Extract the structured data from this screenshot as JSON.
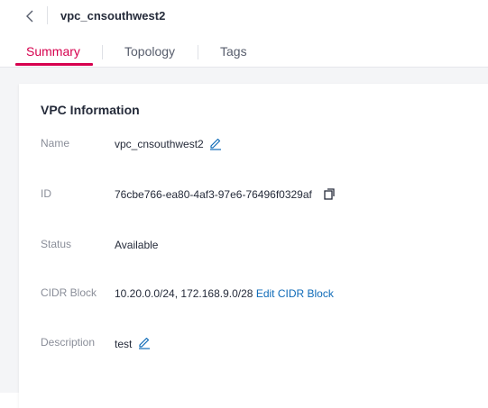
{
  "header": {
    "title": "vpc_cnsouthwest2"
  },
  "tabs": [
    {
      "label": "Summary"
    },
    {
      "label": "Topology"
    },
    {
      "label": "Tags"
    }
  ],
  "card": {
    "title": "VPC Information",
    "fields": {
      "name": {
        "label": "Name",
        "value": "vpc_cnsouthwest2"
      },
      "id": {
        "label": "ID",
        "value": "76cbe766-ea80-4af3-97e6-76496f0329af"
      },
      "status": {
        "label": "Status",
        "value": "Available"
      },
      "cidr": {
        "label": "CIDR Block",
        "value": "10.20.0.0/24, 172.168.9.0/28",
        "action": "Edit CIDR Block"
      },
      "description": {
        "label": "Description",
        "value": "test"
      }
    }
  },
  "icons": {
    "back": "chevron-left-icon",
    "edit": "pencil-icon",
    "copy": "copy-icon"
  },
  "colors": {
    "accent": "#d6004e",
    "link": "#0f6bb8",
    "label": "#8a8e99",
    "text": "#252b3a"
  }
}
